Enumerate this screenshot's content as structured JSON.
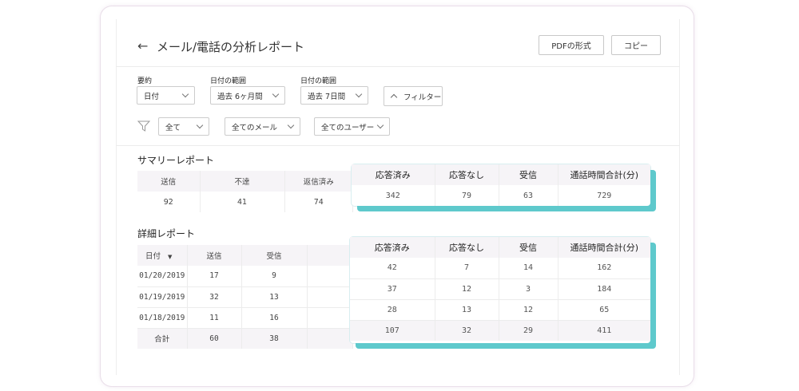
{
  "header": {
    "title": "メール/電話の分析レポート",
    "pdf_button": "PDFの形式",
    "copy_button": "コピー"
  },
  "filters": {
    "summary_label": "要約",
    "summary_value": "日付",
    "range1_label": "日付の範囲",
    "range1_value": "過去 6ヶ月間",
    "range2_label": "日付の範囲",
    "range2_value": "過去 7日間",
    "filter_button": "フィルター",
    "all": "全て",
    "all_mail": "全てのメール",
    "all_users": "全てのユーザー"
  },
  "summary": {
    "title": "サマリーレポート",
    "columns": [
      "送信",
      "不達",
      "返信済み"
    ],
    "values": [
      "92",
      "41",
      "74"
    ],
    "popup_columns": [
      "応答済み",
      "応答なし",
      "受信",
      "通話時間合計(分)"
    ],
    "popup_values": [
      "342",
      "79",
      "63",
      "729"
    ]
  },
  "detail": {
    "title": "詳細レポート",
    "columns": [
      "日付",
      "送信",
      "受信"
    ],
    "rows": [
      [
        "01/20/2019",
        "17",
        "9"
      ],
      [
        "01/19/2019",
        "32",
        "13"
      ],
      [
        "01/18/2019",
        "11",
        "16"
      ]
    ],
    "total": [
      "合計",
      "60",
      "38"
    ],
    "popup_columns": [
      "応答済み",
      "応答なし",
      "受信",
      "通話時間合計(分)"
    ],
    "popup_rows": [
      [
        "42",
        "7",
        "14",
        "162"
      ],
      [
        "37",
        "12",
        "3",
        "184"
      ],
      [
        "28",
        "13",
        "12",
        "65"
      ]
    ],
    "popup_total": [
      "107",
      "32",
      "29",
      "411"
    ]
  }
}
